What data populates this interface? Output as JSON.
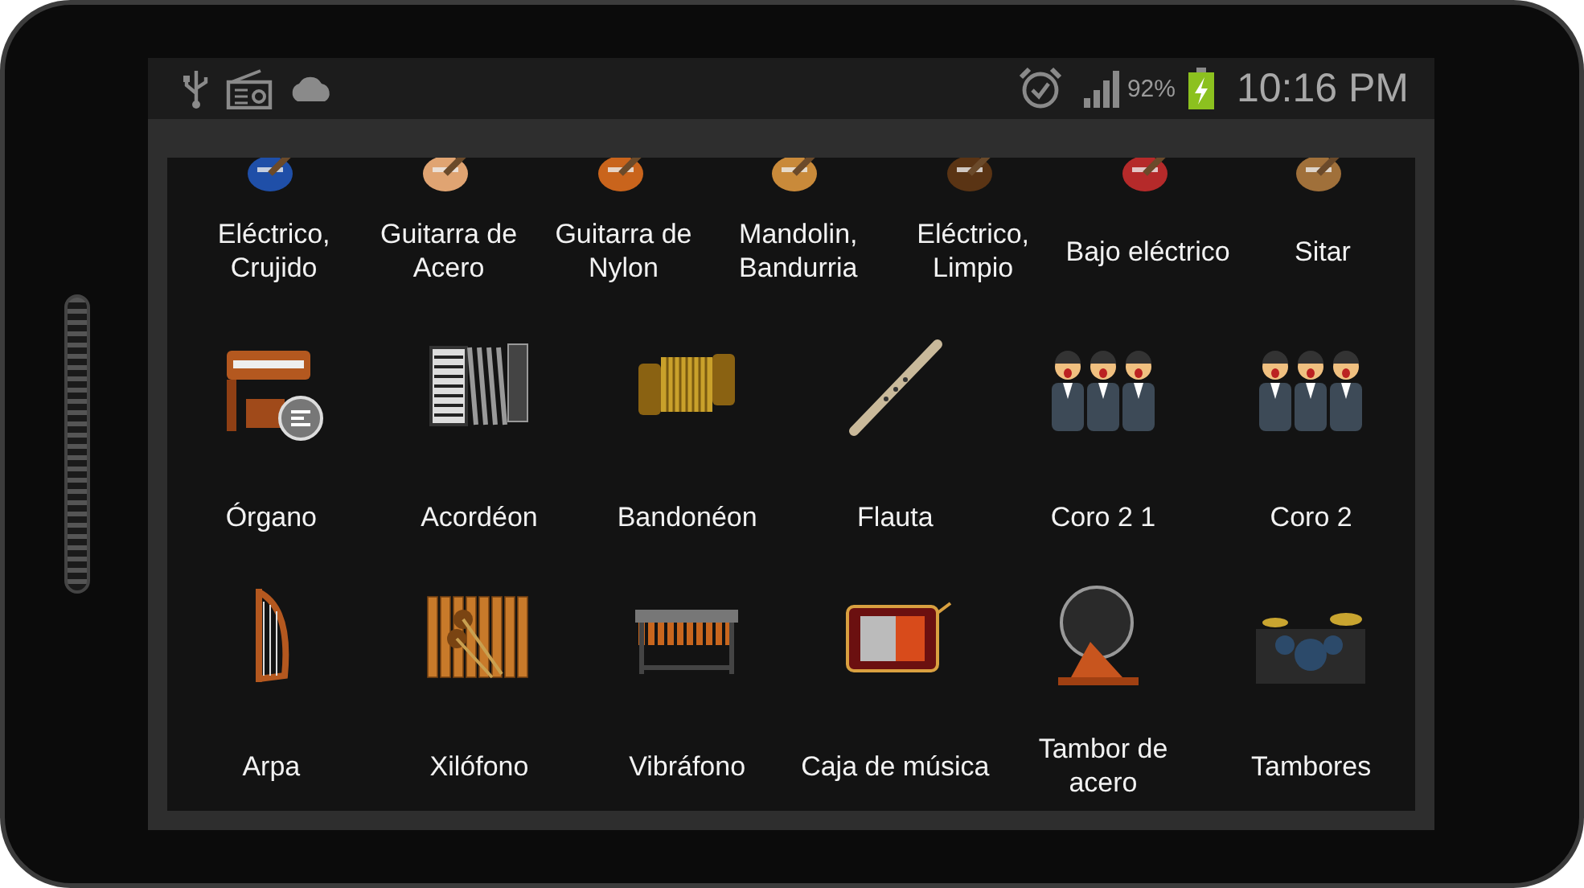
{
  "status_bar": {
    "battery_percent": "92%",
    "time": "10:16 PM"
  },
  "rows": [
    {
      "cropped": true,
      "items": [
        {
          "label": "Eléctrico,\nCrujido",
          "kind": "electric-guitar"
        },
        {
          "label": "Guitarra de\nAcero",
          "kind": "acoustic-guitar"
        },
        {
          "label": "Guitarra de\nNylon",
          "kind": "nylon-guitar"
        },
        {
          "label": "Mandolin,\nBandurria",
          "kind": "mandolin"
        },
        {
          "label": "Eléctrico,\nLimpio",
          "kind": "clean-guitar"
        },
        {
          "label": "Bajo eléctrico",
          "kind": "bass-guitar"
        },
        {
          "label": "Sitar",
          "kind": "sitar"
        }
      ]
    },
    {
      "cropped": false,
      "items": [
        {
          "label": "Órgano",
          "kind": "organ"
        },
        {
          "label": "Acordéon",
          "kind": "accordion"
        },
        {
          "label": "Bandonéon",
          "kind": "bandoneon"
        },
        {
          "label": "Flauta",
          "kind": "flute"
        },
        {
          "label": "Coro 2 1",
          "kind": "choir"
        },
        {
          "label": "Coro 2",
          "kind": "choir"
        }
      ]
    },
    {
      "cropped": false,
      "items": [
        {
          "label": "Arpa",
          "kind": "harp"
        },
        {
          "label": "Xilófono",
          "kind": "xylophone"
        },
        {
          "label": "Vibráfono",
          "kind": "vibraphone"
        },
        {
          "label": "Caja de música",
          "kind": "music-box"
        },
        {
          "label": "Tambor de\nacero",
          "kind": "steel-drum"
        },
        {
          "label": "Tambores",
          "kind": "drum-kit"
        }
      ]
    }
  ]
}
